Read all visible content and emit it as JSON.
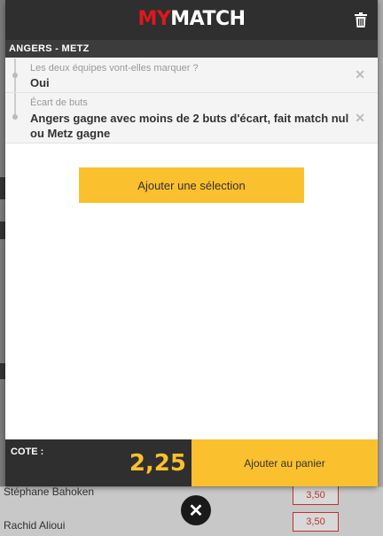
{
  "header": {
    "logo_my": "MY",
    "logo_match": "MATCH",
    "trash_icon": "trash-icon"
  },
  "event": {
    "title": "ANGERS - METZ"
  },
  "selections": [
    {
      "label": "Les deux équipes vont-elles marquer ?",
      "value": "Oui"
    },
    {
      "label": "Écart de buts",
      "value": "Angers gagne avec moins de 2 buts d'écart, fait match nul ou Metz gagne"
    }
  ],
  "add_selection_label": "Ajouter une sélection",
  "footer": {
    "cote_label": "COTE :",
    "cote_value": "2,25",
    "cart_label": "Ajouter au panier"
  },
  "background": {
    "rows": [
      {
        "name": "Stéphane Bahoken",
        "odd": "3,50"
      },
      {
        "name": "Rachid Alioui",
        "odd": "3,50"
      }
    ]
  },
  "colors": {
    "accent": "#fbc02d",
    "brand_red": "#e1161d",
    "dark": "#2f2f2f"
  }
}
